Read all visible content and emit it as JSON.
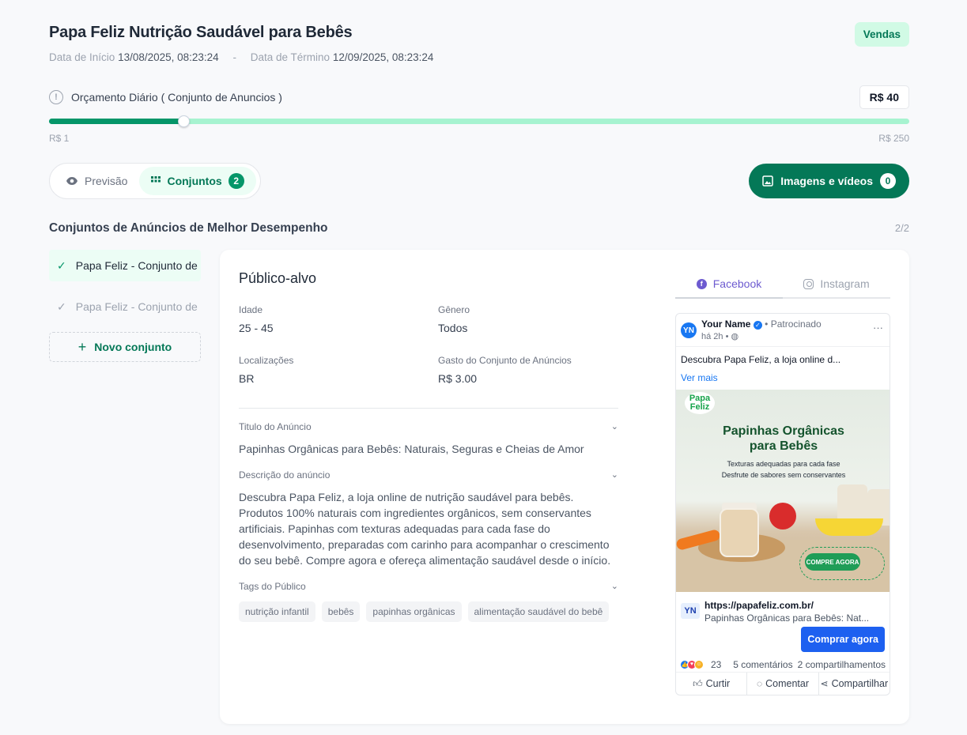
{
  "campaign": {
    "title": "Papa Feliz Nutrição Saudável para Bebês",
    "objective": "Vendas",
    "start_label": "Data de Início",
    "start_value": "13/08/2025, 08:23:24",
    "separator": "-",
    "end_label": "Data de Término",
    "end_value": "12/09/2025, 08:23:24"
  },
  "budget": {
    "label": "Orçamento Diário ( Conjunto de Anuncios )",
    "value": "R$ 40",
    "min_label": "R$ 1",
    "max_label": "R$ 250",
    "min": 1,
    "max": 250,
    "current": 40
  },
  "tabs": {
    "preview_label": "Previsão",
    "sets_label": "Conjuntos",
    "sets_count": "2",
    "media_label": "Imagens e vídeos",
    "media_count": "0"
  },
  "section": {
    "title": "Conjuntos de Anúncios de Melhor Desempenho",
    "pager": "2/2"
  },
  "sidebar": {
    "items": [
      {
        "label": "Papa Feliz - Conjunto de",
        "active": true
      },
      {
        "label": "Papa Feliz - Conjunto de",
        "active": false
      }
    ],
    "new_set_label": "Novo conjunto"
  },
  "audience": {
    "heading": "Público-alvo",
    "age_label": "Idade",
    "age_value": "25 - 45",
    "gender_label": "Gênero",
    "gender_value": "Todos",
    "locations_label": "Localizações",
    "locations_value": "BR",
    "spend_label": "Gasto do Conjunto de Anúncios",
    "spend_value": "R$ 3.00"
  },
  "ad": {
    "title_label": "Titulo do Anúncio",
    "title_value": "Papinhas Orgânicas para Bebês: Naturais, Seguras e Cheias de Amor",
    "description_label": "Descrição do anúncio",
    "description_value": "Descubra Papa Feliz, a loja online de nutrição saudável para bebês. Produtos 100% naturais com ingredientes orgânicos, sem conservantes artificiais. Papinhas com texturas adequadas para cada fase do desenvolvimento, preparadas com carinho para acompanhar o crescimento do seu bebê. Compre agora e ofereça alimentação saudável desde o início.",
    "tags_label": "Tags do Público",
    "tags": [
      "nutrição infantil",
      "bebês",
      "papinhas orgânicas",
      "alimentação saudável do bebê"
    ]
  },
  "preview": {
    "facebook_tab": "Facebook",
    "instagram_tab": "Instagram",
    "avatar_initials": "YN",
    "page_name": "Your Name",
    "sponsored": "• Patrocinado",
    "time": "há 2h •",
    "post_text": "Descubra Papa Feliz, a loja online d...",
    "see_more": "Ver mais",
    "image": {
      "logo": "Papa Feliz",
      "logo_line1": "Papa",
      "logo_line2": "Feliz",
      "headline_line1": "Papinhas Orgânicas",
      "headline_line2": "para Bebês",
      "sub_line1": "Texturas adequadas para cada fase",
      "sub_line2": "Desfrute de sabores sem conservantes",
      "cta": "COMPRE AGORA"
    },
    "link_url": "https://papafeliz.com.br/",
    "link_title": "Papinhas Orgânicas para Bebês: Nat...",
    "cta_button": "Comprar agora",
    "reactions_count": "23",
    "comments": "5 comentários",
    "shares": "2 compartilhamentos",
    "like_label": "Curtir",
    "comment_label": "Comentar",
    "share_label": "Compartilhar"
  },
  "colors": {
    "primary": "#047857",
    "primary_light": "#ecfdf5",
    "slider_track": "#a7f3d0",
    "facebook_blue": "#1877f2",
    "purple_tab": "#6d5bd0"
  }
}
